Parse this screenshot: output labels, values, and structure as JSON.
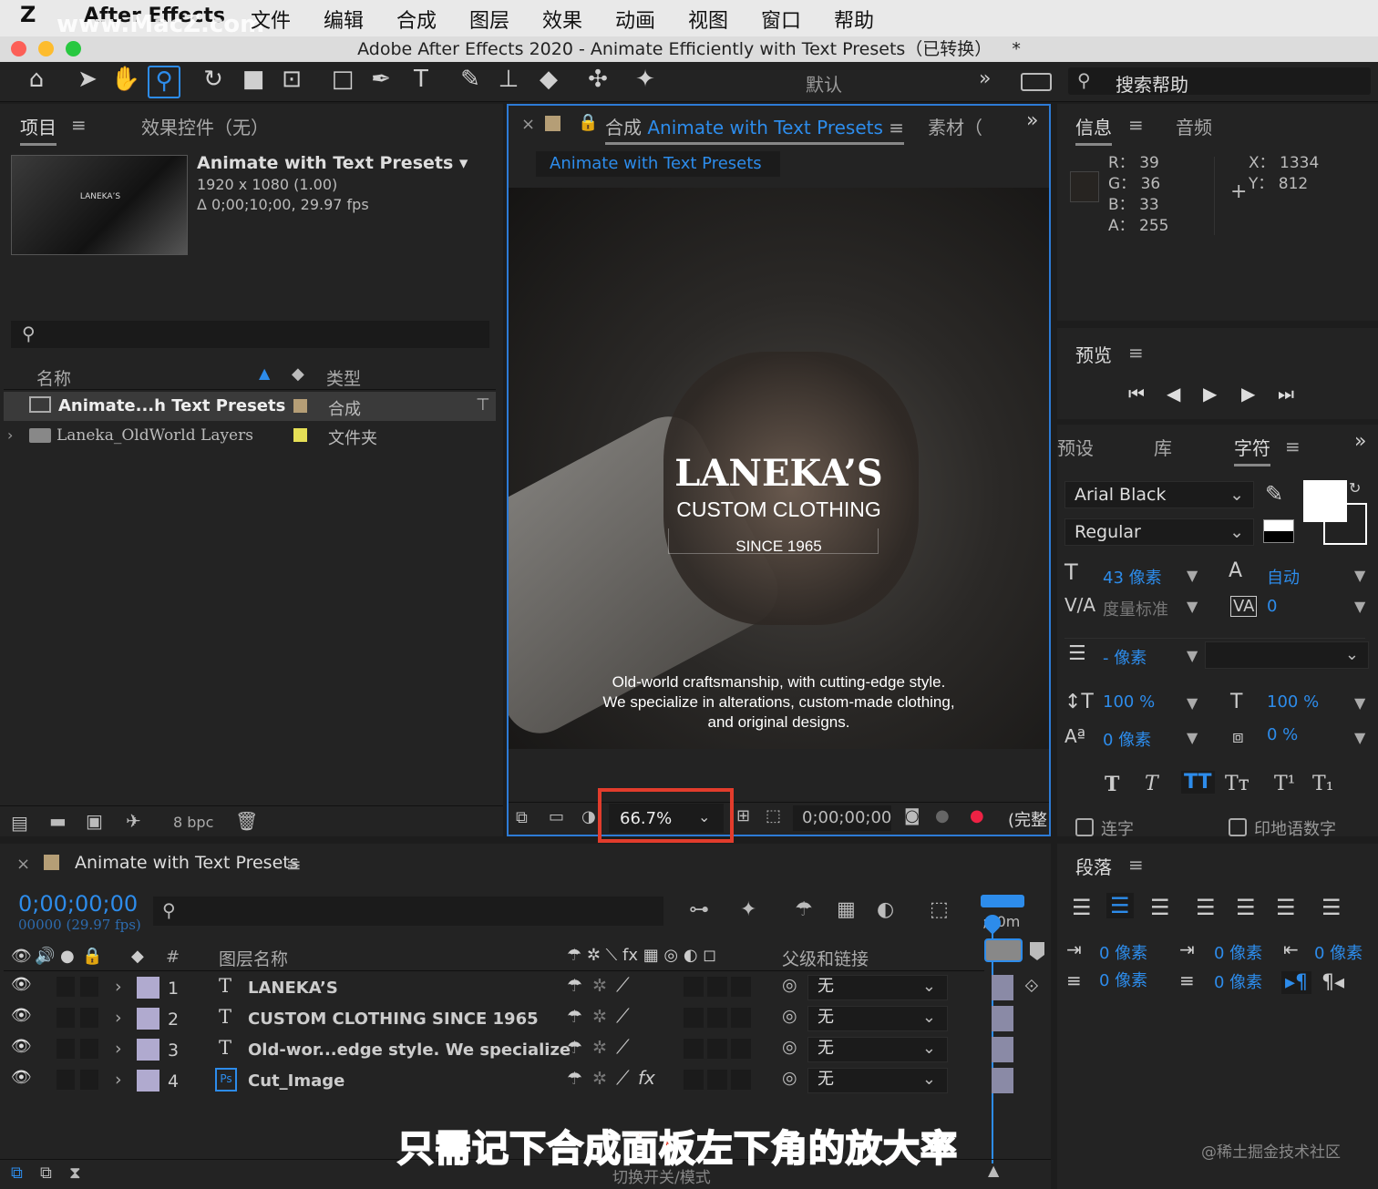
{
  "menubar": {
    "app": "After Effects",
    "watermark": "www.MacZ.com",
    "items": [
      "文件",
      "编辑",
      "合成",
      "图层",
      "效果",
      "动画",
      "视图",
      "窗口",
      "帮助"
    ]
  },
  "window": {
    "title": "Adobe After Effects 2020 - Animate Efficiently with Text Presets（已转换）",
    "modified": "*"
  },
  "toolbar": {
    "workspace": "默认",
    "search_placeholder": "搜索帮助"
  },
  "project": {
    "tab": "项目",
    "effects_tab": "效果控件（无）",
    "comp_name": "Animate with Text Presets",
    "comp_res": "1920 x 1080 (1.00)",
    "comp_dur": "Δ 0;00;10;00, 29.97 fps",
    "col_name": "名称",
    "col_type": "类型",
    "items": [
      {
        "name": "Animate...h Text Presets",
        "type": "合成",
        "color": "#b59e76"
      },
      {
        "name": "Laneka_OldWorld Layers",
        "type": "文件夹",
        "color": "#e5df56"
      }
    ],
    "bpc": "8 bpc"
  },
  "composition": {
    "tab_prefix": "合成",
    "tab_name": "Animate with Text Presets",
    "footage_tab": "素材（",
    "breadcrumb": "Animate with Text Presets",
    "brand": "LANEKA’S",
    "sub": "CUSTOM CLOTHING",
    "since": "SINCE 1965",
    "body": [
      "Old-world craftsmanship, with cutting-edge style.",
      "We specialize in alterations, custom-made clothing,",
      "and original designs."
    ],
    "zoom": "66.7%",
    "timecode": "0;00;00;00",
    "quality": "(完整"
  },
  "info": {
    "tab": "信息",
    "audio_tab": "音频",
    "r": "R： 39",
    "g": "G： 36",
    "b": "B： 33",
    "a": "A： 255",
    "x": "X： 1334",
    "y": "Y： 812"
  },
  "preview": {
    "tab": "预览"
  },
  "character": {
    "tabs": [
      "预设",
      "库",
      "字符"
    ],
    "font": "Arial Black",
    "style": "Regular",
    "size": "43 像素",
    "leading": "自动",
    "kerning": "度量标准",
    "tracking": "0",
    "stroke": "- 像素",
    "vscale": "100 %",
    "hscale": "100 %",
    "baseline": "0 像素",
    "tsume": "0 %",
    "styles": [
      "T",
      "T",
      "TT",
      "Tт",
      "T¹",
      "T₁"
    ],
    "ligature": "连字",
    "hindi": "印地语数字"
  },
  "paragraph": {
    "tab": "段落",
    "indent_left": "0 像素",
    "indent_first": "0 像素",
    "indent_right": "0 像素",
    "space_before": "0 像素",
    "space_after": "0 像素"
  },
  "timeline": {
    "tab": "Animate with Text Presets",
    "timecode": "0;00;00;00",
    "frames": "00000 (29.97 fps)",
    "col_num": "#",
    "col_layer": "图层名称",
    "col_parent": "父级和链接",
    "footer": "切换开关/模式",
    "ruler": ";00m",
    "layers": [
      {
        "num": "1",
        "icon": "T",
        "name": "LANEKA’S",
        "parent": "无"
      },
      {
        "num": "2",
        "icon": "T",
        "name": "CUSTOM CLOTHING  SINCE 1965",
        "parent": "无"
      },
      {
        "num": "3",
        "icon": "T",
        "name": "Old-wor...edge style. We specialize",
        "parent": "无"
      },
      {
        "num": "4",
        "icon": "Ps",
        "name": "Cut_Image",
        "parent": "无"
      }
    ]
  },
  "annotation": {
    "caption": "只需记下合成面板左下角的放大率",
    "credit": "@稀土掘金技术社区",
    "highlight_color": "#e23c2c"
  }
}
